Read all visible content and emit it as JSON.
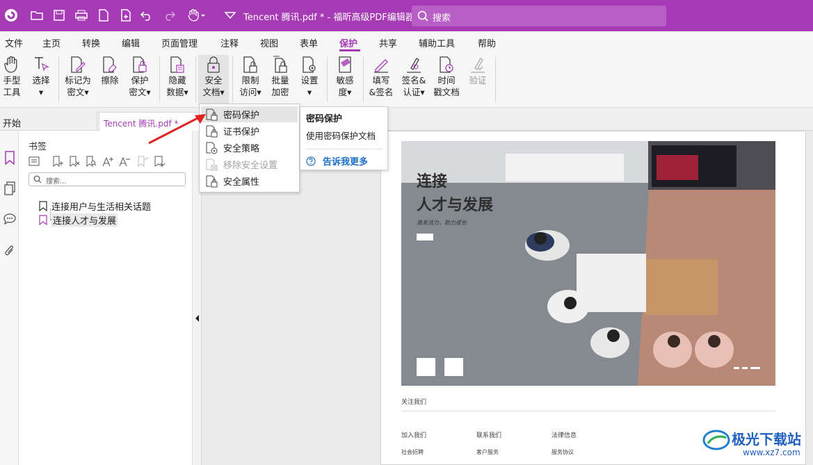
{
  "title_bar": {
    "document_title": "Tencent 腾讯.pdf * - 福昕高级PDF编辑器",
    "search_placeholder": "搜索",
    "accent_color": "#a63bb5"
  },
  "menu": [
    "文件",
    "主页",
    "转换",
    "编辑",
    "页面管理",
    "注释",
    "视图",
    "表单",
    "保护",
    "共享",
    "辅助工具",
    "帮助"
  ],
  "active_menu": "保护",
  "ribbon": [
    {
      "line1": "手型",
      "line2": "工具",
      "icon": "hand-icon"
    },
    {
      "line1": "选择",
      "line2": "▾",
      "icon": "select-text-icon"
    },
    {
      "line1": "标记为",
      "line2": "密文▾",
      "icon": "mark-redact-icon"
    },
    {
      "line1": "擦除",
      "line2": "",
      "icon": "erase-icon"
    },
    {
      "line1": "保护",
      "line2": "密文▾",
      "icon": "protect-redact-icon"
    },
    {
      "line1": "隐藏",
      "line2": "数据▾",
      "icon": "hide-data-icon"
    },
    {
      "line1": "安全",
      "line2": "文档▾",
      "icon": "secure-doc-icon"
    },
    {
      "line1": "限制",
      "line2": "访问▾",
      "icon": "restrict-access-icon"
    },
    {
      "line1": "批量",
      "line2": "加密",
      "icon": "batch-encrypt-icon"
    },
    {
      "line1": "设置",
      "line2": "▾",
      "icon": "settings-icon"
    },
    {
      "line1": "敏感",
      "line2": "度▾",
      "icon": "sensitivity-icon"
    },
    {
      "line1": "填写",
      "line2": "&签名",
      "icon": "fill-sign-icon"
    },
    {
      "line1": "签名&",
      "line2": "认证▾",
      "icon": "sign-certify-icon"
    },
    {
      "line1": "时间",
      "line2": "戳文档",
      "icon": "timestamp-icon"
    },
    {
      "line1": "验证",
      "line2": "",
      "icon": "verify-icon"
    }
  ],
  "tabs": {
    "home": "开始",
    "document": "Tencent 腾讯.pdf *"
  },
  "bookmarks": {
    "title": "书签",
    "search_placeholder": "搜索...",
    "items": [
      "连接用户与生活相关话题",
      "连接人才与发展"
    ]
  },
  "dropdown": {
    "items": [
      {
        "label": "密码保护",
        "icon": "password-lock-icon",
        "state": "highlighted"
      },
      {
        "label": "证书保护",
        "icon": "certificate-lock-icon",
        "state": "normal"
      },
      {
        "label": "安全策略",
        "icon": "security-policy-icon",
        "state": "normal"
      },
      {
        "label": "移除安全设置",
        "icon": "remove-security-icon",
        "state": "disabled"
      },
      {
        "label": "安全属性",
        "icon": "security-properties-icon",
        "state": "normal"
      }
    ]
  },
  "tooltip": {
    "title": "密码保护",
    "description": "使用密码保护文档",
    "link": "告诉我更多"
  },
  "document_page": {
    "hero_title_1": "连接",
    "hero_title_2": "人才与发展",
    "hero_subtitle": "激发活力，助力成长",
    "footer_heading": "关注我们",
    "columns": [
      {
        "heading": "加入我们",
        "item": "社会招聘"
      },
      {
        "heading": "联系我们",
        "item": "客户服务"
      },
      {
        "heading": "法律信息",
        "item": "服务协议"
      }
    ]
  },
  "watermark": {
    "text": "极光下载站",
    "url": "www.xz7.com"
  }
}
